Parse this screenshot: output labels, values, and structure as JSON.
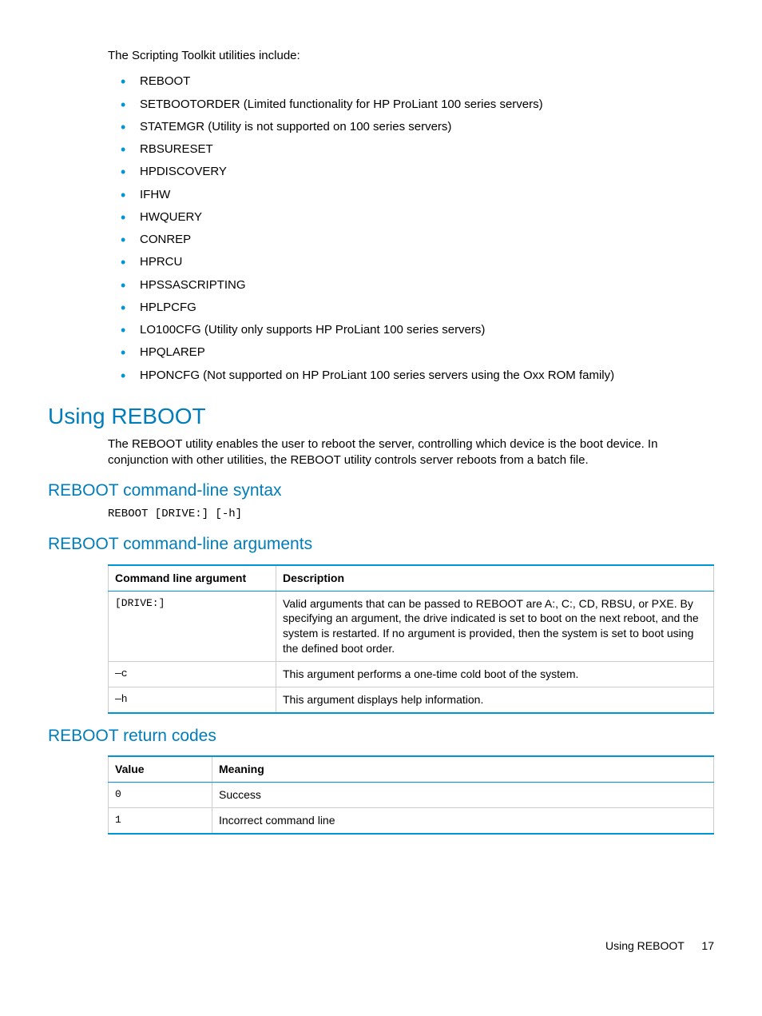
{
  "intro": "The Scripting Toolkit utilities include:",
  "utilities": [
    "REBOOT",
    "SETBOOTORDER (Limited functionality for HP ProLiant 100 series servers)",
    "STATEMGR (Utility is not supported on 100 series servers)",
    "RBSURESET",
    "HPDISCOVERY",
    "IFHW",
    "HWQUERY",
    "CONREP",
    "HPRCU",
    "HPSSASCRIPTING",
    "HPLPCFG",
    "LO100CFG (Utility only supports HP ProLiant 100 series servers)",
    "HPQLAREP",
    "HPONCFG (Not supported on HP ProLiant 100 series servers using the Oxx ROM family)"
  ],
  "section": {
    "title": "Using REBOOT",
    "desc": "The REBOOT utility enables the user to reboot the server, controlling which device is the boot device. In conjunction with other utilities, the REBOOT utility controls server reboots from a batch file."
  },
  "syntax": {
    "title": "REBOOT command-line syntax",
    "code": "REBOOT [DRIVE:] [-h]"
  },
  "args": {
    "title": "REBOOT command-line arguments",
    "headers": [
      "Command line argument",
      "Description"
    ],
    "rows": [
      {
        "arg": "[DRIVE:]",
        "desc": "Valid arguments that can be passed to REBOOT are A:, C:, CD, RBSU, or PXE. By specifying an argument, the drive indicated is set to boot on the next reboot, and the system is restarted. If no argument is provided, then the system is set to boot using the defined boot order."
      },
      {
        "arg": "—c",
        "desc": "This argument performs a one-time cold boot of the system."
      },
      {
        "arg": "—h",
        "desc": "This argument displays help information."
      }
    ]
  },
  "codes": {
    "title": "REBOOT return codes",
    "headers": [
      "Value",
      "Meaning"
    ],
    "rows": [
      {
        "val": "0",
        "mean": "Success"
      },
      {
        "val": "1",
        "mean": "Incorrect command line"
      }
    ]
  },
  "footer": {
    "label": "Using REBOOT",
    "page": "17"
  }
}
